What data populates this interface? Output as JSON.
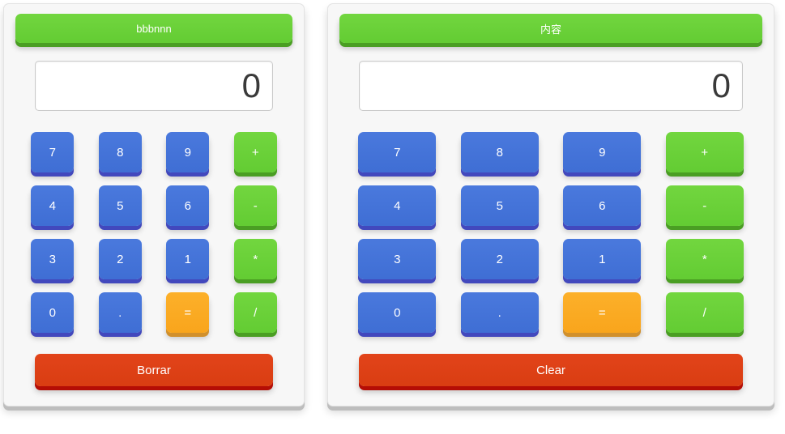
{
  "page": {
    "background_color": "#ffffff"
  },
  "theme": {
    "number_key_color": "#4472d8",
    "number_key_edge_color": "#4248bd",
    "operator_key_color": "#66cc33",
    "operator_key_edge_color": "#4a9e23",
    "equals_key_color": "#f9a825",
    "equals_key_edge_color": "#d1902c",
    "clear_key_color": "#dd4114",
    "clear_key_edge_color": "#b50d05",
    "panel_background_color": "#f7f7f7",
    "panel_edge_color": "#bdbdbd",
    "display_text_color": "#3a3a3a"
  },
  "calculators": [
    {
      "id": "calculator-left",
      "header_label": "bbbnnn",
      "display_value": "0",
      "display_placeholder": "0",
      "keys": [
        {
          "label": "7",
          "kind": "num"
        },
        {
          "label": "8",
          "kind": "num"
        },
        {
          "label": "9",
          "kind": "num"
        },
        {
          "label": "+",
          "kind": "op"
        },
        {
          "label": "4",
          "kind": "num"
        },
        {
          "label": "5",
          "kind": "num"
        },
        {
          "label": "6",
          "kind": "num"
        },
        {
          "label": "-",
          "kind": "op"
        },
        {
          "label": "3",
          "kind": "num"
        },
        {
          "label": "2",
          "kind": "num"
        },
        {
          "label": "1",
          "kind": "num"
        },
        {
          "label": "*",
          "kind": "op"
        },
        {
          "label": "0",
          "kind": "num"
        },
        {
          "label": ".",
          "kind": "num"
        },
        {
          "label": "=",
          "kind": "eq"
        },
        {
          "label": "/",
          "kind": "op"
        }
      ],
      "clear_label": "Borrar"
    },
    {
      "id": "calculator-right",
      "header_label": "内容",
      "display_value": "0",
      "display_placeholder": "0",
      "keys": [
        {
          "label": "7",
          "kind": "num"
        },
        {
          "label": "8",
          "kind": "num"
        },
        {
          "label": "9",
          "kind": "num"
        },
        {
          "label": "+",
          "kind": "op"
        },
        {
          "label": "4",
          "kind": "num"
        },
        {
          "label": "5",
          "kind": "num"
        },
        {
          "label": "6",
          "kind": "num"
        },
        {
          "label": "-",
          "kind": "op"
        },
        {
          "label": "3",
          "kind": "num"
        },
        {
          "label": "2",
          "kind": "num"
        },
        {
          "label": "1",
          "kind": "num"
        },
        {
          "label": "*",
          "kind": "op"
        },
        {
          "label": "0",
          "kind": "num"
        },
        {
          "label": ".",
          "kind": "num"
        },
        {
          "label": "=",
          "kind": "eq"
        },
        {
          "label": "/",
          "kind": "op"
        }
      ],
      "clear_label": "Clear"
    }
  ]
}
